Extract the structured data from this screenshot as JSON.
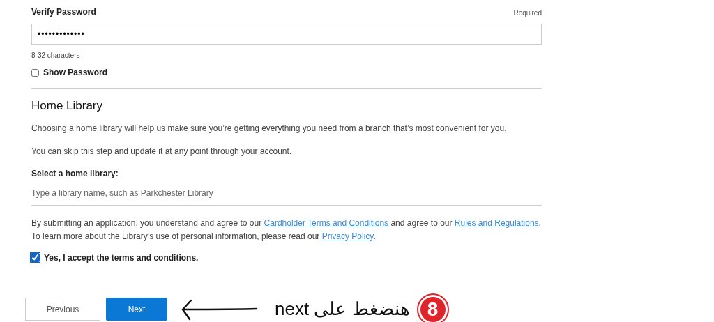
{
  "verify_password": {
    "label": "Verify Password",
    "required_text": "Required",
    "value": "•••••••••••••",
    "hint": "8-32 characters"
  },
  "show_password": {
    "label": "Show Password",
    "checked": false
  },
  "home_library": {
    "heading": "Home Library",
    "paragraphs": [
      "Choosing a home library will help us make sure you’re getting everything you need from a branch that’s most convenient for you.",
      "You can skip this step and update it at any point through your account."
    ],
    "select_label": "Select a home library:",
    "placeholder": "Type a library name, such as Parkchester Library"
  },
  "terms": [
    {
      "kind": "text",
      "text": "By submitting an application, you understand and agree to our "
    },
    {
      "kind": "link",
      "text": "Cardholder Terms and Conditions"
    },
    {
      "kind": "text",
      "text": " and agree to our "
    },
    {
      "kind": "link",
      "text": "Rules and Regulations"
    },
    {
      "kind": "text",
      "text": ". To learn more about the Library’s use of personal information, please read our "
    },
    {
      "kind": "link",
      "text": "Privacy Policy"
    },
    {
      "kind": "text",
      "text": "."
    }
  ],
  "accept": {
    "label": "Yes, I accept the terms and conditions.",
    "checked": true
  },
  "buttons": [
    {
      "label": "Previous",
      "kind": "secondary"
    },
    {
      "label": "Next",
      "kind": "primary"
    }
  ],
  "annotation": {
    "text": "هنضغط على next",
    "step": "8"
  }
}
